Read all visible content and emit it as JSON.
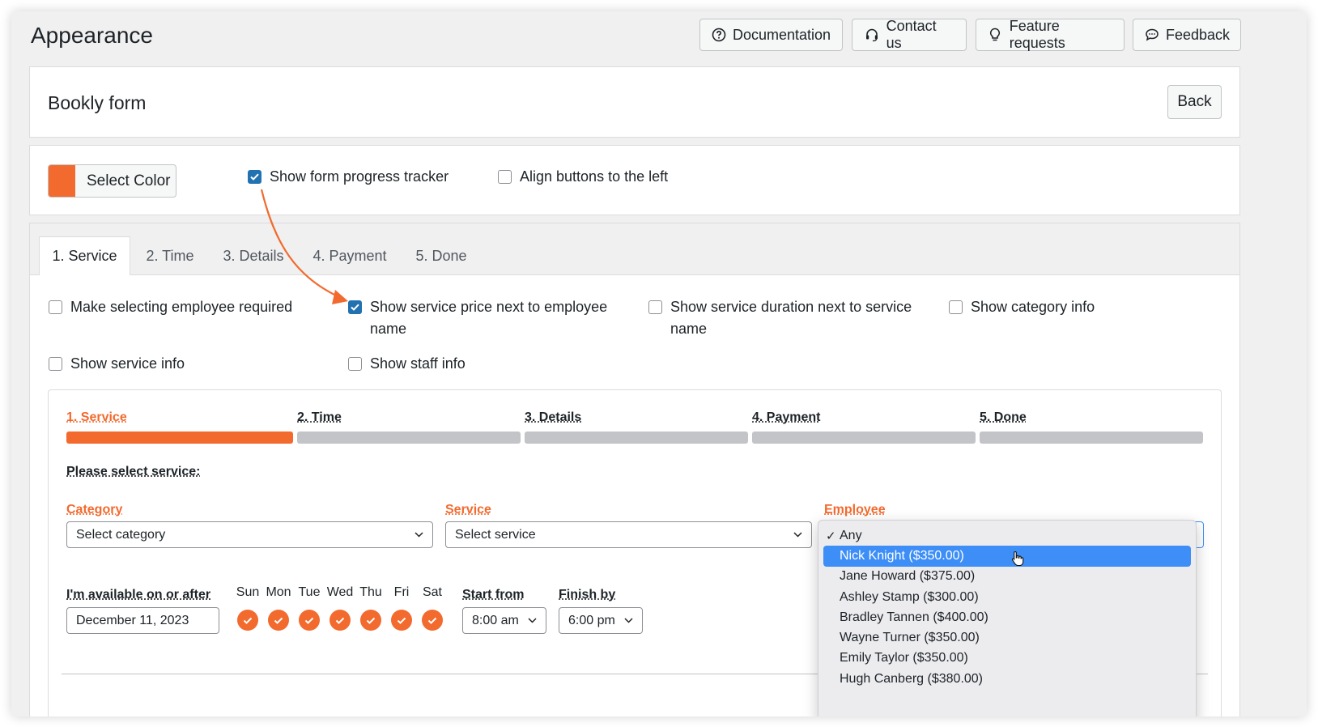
{
  "page_title": "Appearance",
  "header_buttons": [
    {
      "label": "Documentation",
      "icon": "question-circle-icon"
    },
    {
      "label": "Contact us",
      "icon": "headset-icon"
    },
    {
      "label": "Feature requests",
      "icon": "lightbulb-icon"
    },
    {
      "label": "Feedback",
      "icon": "chat-bubble-icon"
    }
  ],
  "form_card": {
    "title": "Bookly form",
    "back_label": "Back"
  },
  "settings": {
    "select_color_label": "Select Color",
    "color_swatch": "#f26a2e",
    "show_progress_tracker": {
      "label": "Show form progress tracker",
      "checked": true
    },
    "align_buttons_left": {
      "label": "Align buttons to the left",
      "checked": false
    }
  },
  "tabs": [
    "1. Service",
    "2. Time",
    "3. Details",
    "4. Payment",
    "5. Done"
  ],
  "active_tab": "1. Service",
  "service_options": [
    {
      "label": "Make selecting employee required",
      "checked": false
    },
    {
      "label": "Show service price next to employee name",
      "checked": true
    },
    {
      "label": "Show service duration next to service name",
      "checked": false
    },
    {
      "label": "Show category info",
      "checked": false
    },
    {
      "label": "Show service info",
      "checked": false
    },
    {
      "label": "Show staff info",
      "checked": false
    }
  ],
  "preview": {
    "steps": [
      "1. Service",
      "2. Time",
      "3. Details",
      "4. Payment",
      "5. Done"
    ],
    "active_step": 1,
    "accent_color": "#f26a2e",
    "please_select": "Please select service:",
    "category_label": "Category",
    "category_value": "Select category",
    "service_label": "Service",
    "service_value": "Select service",
    "employee_label": "Employee",
    "available_label": "I'm available on or after",
    "date_value": "December 11, 2023",
    "days": [
      "Sun",
      "Mon",
      "Tue",
      "Wed",
      "Thu",
      "Fri",
      "Sat"
    ],
    "start_label": "Start from",
    "start_value": "8:00 am",
    "finish_label": "Finish by",
    "finish_value": "6:00 pm"
  },
  "employee_dropdown": {
    "selected": "Any",
    "highlighted": "Nick Knight ($350.00)",
    "options": [
      "Any",
      "Nick Knight ($350.00)",
      "Jane Howard ($375.00)",
      "Ashley Stamp ($300.00)",
      "Bradley Tannen ($400.00)",
      "Wayne Turner ($350.00)",
      "Emily Taylor ($350.00)",
      "Hugh Canberg ($380.00)"
    ]
  }
}
